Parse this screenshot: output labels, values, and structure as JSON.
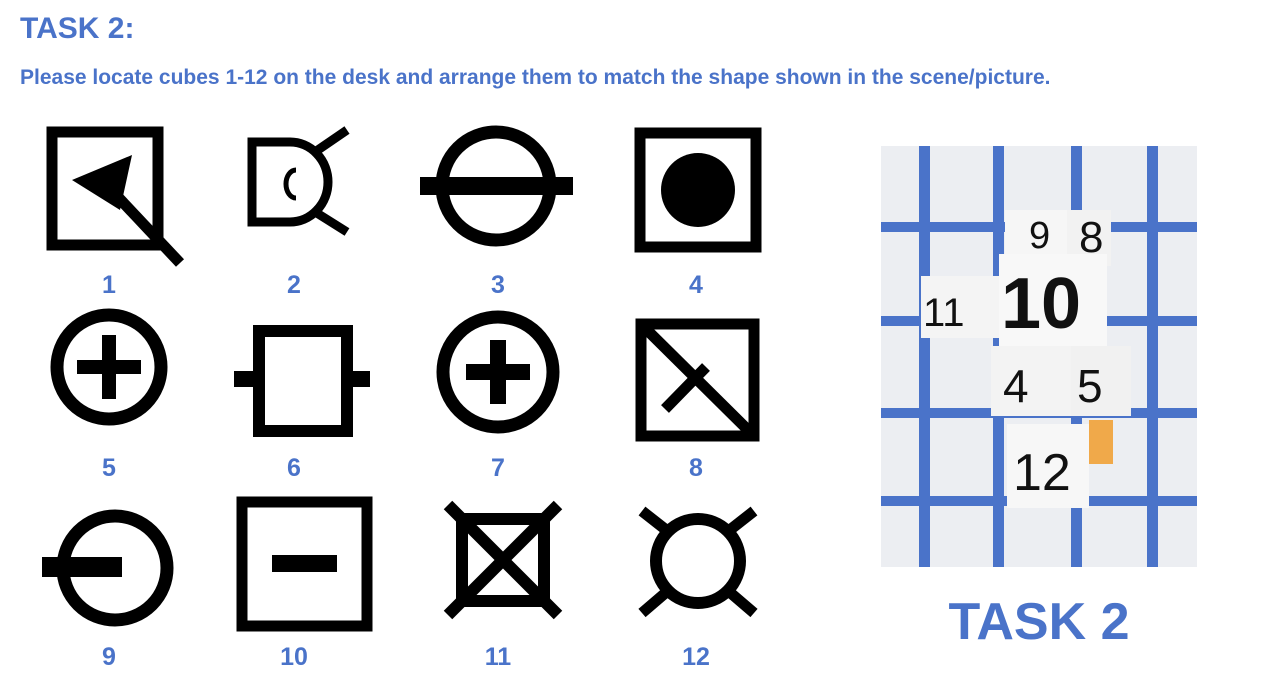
{
  "header": {
    "title": "TASK 2:",
    "instruction": "Please locate cubes 1-12 on the desk and arrange them to match the shape shown in the scene/picture."
  },
  "colors": {
    "accent": "#4a73c9",
    "grid": "#4a73c9",
    "symbol": "#000000",
    "marker": "#f0a94a"
  },
  "symbols": [
    {
      "number": "1",
      "icon": "square-arrow-icon"
    },
    {
      "number": "2",
      "icon": "d-cross-icon"
    },
    {
      "number": "3",
      "icon": "circle-bar-icon"
    },
    {
      "number": "4",
      "icon": "square-dot-icon"
    },
    {
      "number": "5",
      "icon": "circle-plus-icon"
    },
    {
      "number": "6",
      "icon": "resistor-icon"
    },
    {
      "number": "7",
      "icon": "circle-plus-icon"
    },
    {
      "number": "8",
      "icon": "square-diagonal-icon"
    },
    {
      "number": "9",
      "icon": "circle-stub-icon"
    },
    {
      "number": "10",
      "icon": "square-minus-icon"
    },
    {
      "number": "11",
      "icon": "square-x-icon"
    },
    {
      "number": "12",
      "icon": "circle-x-icon"
    }
  ],
  "scene": {
    "caption": "TASK 2",
    "cube_labels": [
      "9",
      "8",
      "11",
      "10",
      "4",
      "5",
      "12"
    ]
  }
}
